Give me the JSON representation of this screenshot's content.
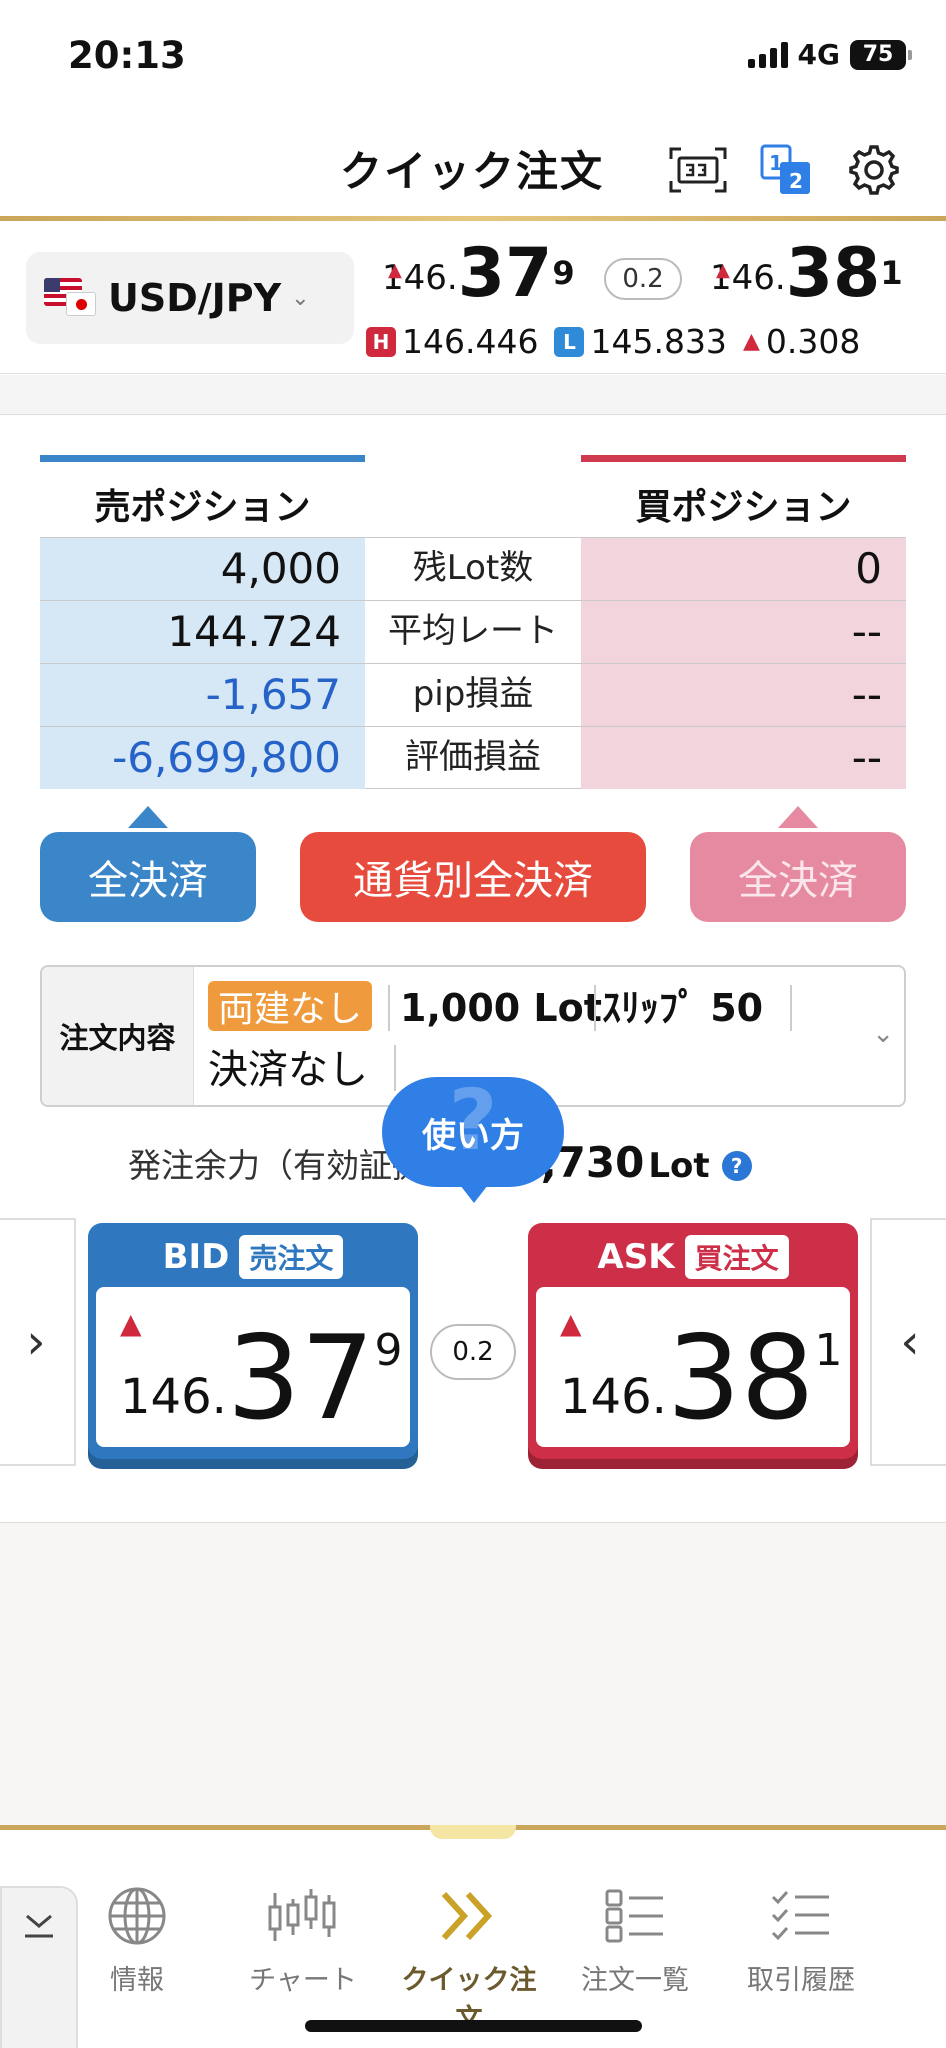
{
  "status": {
    "time": "20:13",
    "network": "4G",
    "battery": "75"
  },
  "header": {
    "title": "クイック注文",
    "icons": [
      "screen-mode-icon",
      "split-view-icon",
      "gear-icon"
    ],
    "split_labels": [
      "1",
      "2"
    ]
  },
  "rate": {
    "pair": "USD/JPY",
    "bid": {
      "prefix": "146.",
      "main": "37",
      "pip": "9"
    },
    "spread": "0.2",
    "ask": {
      "prefix": "146.",
      "main": "38",
      "pip": "1"
    },
    "high_label": "H",
    "high": "146.446",
    "low_label": "L",
    "low": "145.833",
    "change": "0.308"
  },
  "positions": {
    "sell_header": "売ポジション",
    "buy_header": "買ポジション",
    "rows": [
      {
        "label": "残Lot数",
        "sell": "4,000",
        "buy": "0"
      },
      {
        "label": "平均レート",
        "sell": "144.724",
        "buy": "--"
      },
      {
        "label": "pip損益",
        "sell": "-1,657",
        "buy": "--"
      },
      {
        "label": "評価損益",
        "sell": "-6,699,800",
        "buy": "--"
      }
    ]
  },
  "buttons": {
    "close_sell": "全決済",
    "close_by_currency": "通貨別全決済",
    "close_buy": "全決済"
  },
  "order": {
    "label": "注文内容",
    "hedge": "両建なし",
    "lot": "1,000 Lot",
    "slippage": "ｽﾘｯﾌﾟ 50",
    "settle": "決済なし"
  },
  "margin": {
    "label": "発注余力（有効証拠金）：",
    "value": "1,730",
    "unit": "Lot"
  },
  "howto": {
    "label": "使い方",
    "bg": "?"
  },
  "cards": {
    "bid": {
      "title": "BID",
      "tag": "売注文",
      "prefix": "146.",
      "main": "37",
      "pip": "9"
    },
    "spread": "0.2",
    "ask": {
      "title": "ASK",
      "tag": "買注文",
      "prefix": "146.",
      "main": "38",
      "pip": "1"
    }
  },
  "nav": {
    "tabs": [
      {
        "label": "情報",
        "icon": "globe-icon"
      },
      {
        "label": "チャート",
        "icon": "candlestick-icon"
      },
      {
        "label": "クイック注文",
        "icon": "double-chevron-icon",
        "active": true
      },
      {
        "label": "注文一覧",
        "icon": "list-icon"
      },
      {
        "label": "取引履歴",
        "icon": "checklist-icon"
      }
    ]
  },
  "colors": {
    "sell": "#3a86c8",
    "buy": "#cf3a4f",
    "accent_gold": "#c9a65a",
    "close_currency": "#e74b3d"
  }
}
